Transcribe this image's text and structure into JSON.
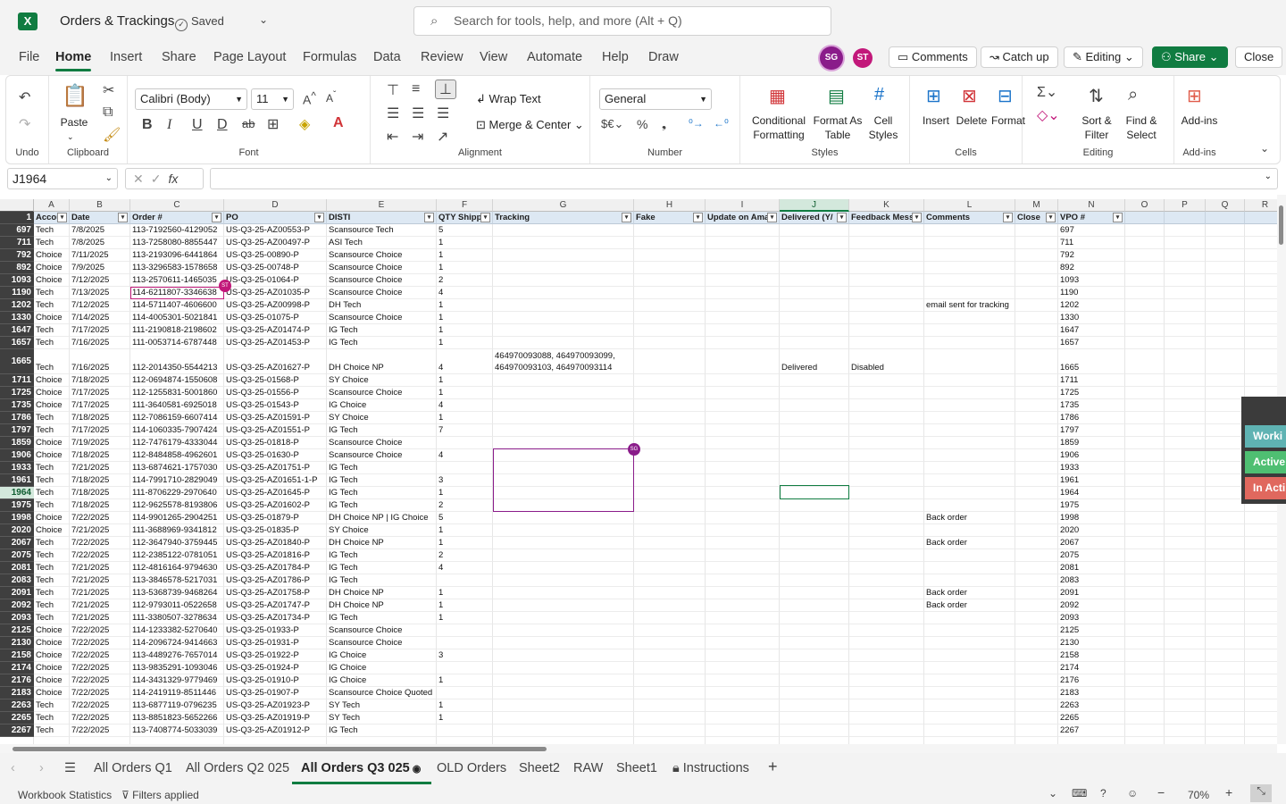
{
  "app": {
    "logo": "X",
    "title": "Orders & Trackings",
    "saved": "Saved",
    "search_placeholder": "Search for tools, help, and more (Alt + Q)"
  },
  "menu": [
    "File",
    "Home",
    "Insert",
    "Share",
    "Page Layout",
    "Formulas",
    "Data",
    "Review",
    "View",
    "Automate",
    "Help",
    "Draw"
  ],
  "header_buttons": {
    "avatar1": "SG",
    "avatar2": "ST",
    "comments": "Comments",
    "catchup": "Catch up",
    "editing": "Editing",
    "share": "Share",
    "close": "Close"
  },
  "ribbon": {
    "undo_label": "Undo",
    "clipboard": {
      "paste": "Paste",
      "label": "Clipboard"
    },
    "font": {
      "name": "Calibri (Body)",
      "size": "11",
      "label": "Font"
    },
    "alignment": {
      "wrap": "Wrap Text",
      "merge": "Merge & Center",
      "label": "Alignment"
    },
    "number": {
      "format": "General",
      "label": "Number"
    },
    "styles": {
      "cond": "Conditional Formatting",
      "table": "Format As Table",
      "cell": "Cell Styles",
      "label": "Styles"
    },
    "cells": {
      "insert": "Insert",
      "delete": "Delete",
      "format": "Format",
      "label": "Cells"
    },
    "editing": {
      "sort": "Sort & Filter",
      "find": "Find & Select",
      "label": "Editing"
    },
    "addins": {
      "btn": "Add-ins",
      "label": "Add-ins"
    }
  },
  "formula_bar": {
    "namebox": "J1964",
    "value": ""
  },
  "columns": [
    "A",
    "B",
    "C",
    "D",
    "E",
    "F",
    "G",
    "H",
    "I",
    "J",
    "K",
    "L",
    "M",
    "N",
    "O",
    "P",
    "Q",
    "R"
  ],
  "headers": [
    "Accou",
    "Date",
    "Order #",
    "PO",
    "DISTI",
    "QTY Shippe",
    "Tracking",
    "Fake",
    "Update on Ama",
    "Delivered (Y/",
    "Feedback Mess",
    "Comments",
    "Close",
    "VPO #",
    "",
    "",
    "",
    ""
  ],
  "rows": [
    {
      "n": "697",
      "a": "Tech",
      "b": "7/8/2025",
      "c": "113-7192560-4129052",
      "d": "US-Q3-25-AZ00553-P",
      "e": "Scansource Tech",
      "f": "5"
    },
    {
      "n": "711",
      "a": "Tech",
      "b": "7/8/2025",
      "c": "113-7258080-8855447",
      "d": "US-Q3-25-AZ00497-P",
      "e": "ASI Tech",
      "f": "1"
    },
    {
      "n": "792",
      "a": "Choice",
      "b": "7/11/2025",
      "c": "113-2193096-6441864",
      "d": "US-Q3-25-00890-P",
      "e": "Scansource Choice",
      "f": "1"
    },
    {
      "n": "892",
      "a": "Choice",
      "b": "7/9/2025",
      "c": "113-3296583-1578658",
      "d": "US-Q3-25-00748-P",
      "e": "Scansource Choice",
      "f": "1"
    },
    {
      "n": "1093",
      "a": "Choice",
      "b": "7/12/2025",
      "c": "113-2570611-1465035",
      "d": "US-Q3-25-01064-P",
      "e": "Scansource Choice",
      "f": "2"
    },
    {
      "n": "1190",
      "a": "Tech",
      "b": "7/13/2025",
      "c": "114-6211807-3346638",
      "d": "US-Q3-25-AZ01035-P",
      "e": "Scansource Choice",
      "f": "4"
    },
    {
      "n": "1202",
      "a": "Tech",
      "b": "7/12/2025",
      "c": "114-5711407-4606600",
      "d": "US-Q3-25-AZ00998-P",
      "e": "DH Tech",
      "f": "1",
      "l": "email sent for tracking"
    },
    {
      "n": "1330",
      "a": "Choice",
      "b": "7/14/2025",
      "c": "114-4005301-5021841",
      "d": "US-Q3-25-01075-P",
      "e": "Scansource Choice",
      "f": "1"
    },
    {
      "n": "1647",
      "a": "Tech",
      "b": "7/17/2025",
      "c": "111-2190818-2198602",
      "d": "US-Q3-25-AZ01474-P",
      "e": "IG Tech",
      "f": "1"
    },
    {
      "n": "1657",
      "a": "Tech",
      "b": "7/16/2025",
      "c": "111-0053714-6787448",
      "d": "US-Q3-25-AZ01453-P",
      "e": "IG Tech",
      "f": "1"
    },
    {
      "n": "1665",
      "a": "Tech",
      "b": "7/16/2025",
      "c": "112-2014350-5544213",
      "d": "US-Q3-25-AZ01627-P",
      "e": "DH Choice NP",
      "f": "4",
      "g": "464970093088, 464970093099,",
      "g2": "464970093103, 464970093114",
      "j": "Delivered",
      "k": "Disabled",
      "tall": true
    },
    {
      "n": "1711",
      "a": "Choice",
      "b": "7/18/2025",
      "c": "112-0694874-1550608",
      "d": "US-Q3-25-01568-P",
      "e": "SY Choice",
      "f": "1"
    },
    {
      "n": "1725",
      "a": "Choice",
      "b": "7/17/2025",
      "c": "112-1255831-5001860",
      "d": "US-Q3-25-01556-P",
      "e": "Scansource Choice",
      "f": "1"
    },
    {
      "n": "1735",
      "a": "Choice",
      "b": "7/17/2025",
      "c": "111-3640581-6925018",
      "d": "US-Q3-25-01543-P",
      "e": "IG Choice",
      "f": "4"
    },
    {
      "n": "1786",
      "a": "Tech",
      "b": "7/18/2025",
      "c": "112-7086159-6607414",
      "d": "US-Q3-25-AZ01591-P",
      "e": "SY Choice",
      "f": "1"
    },
    {
      "n": "1797",
      "a": "Tech",
      "b": "7/17/2025",
      "c": "114-1060335-7907424",
      "d": "US-Q3-25-AZ01551-P",
      "e": "IG Tech",
      "f": "7"
    },
    {
      "n": "1859",
      "a": "Choice",
      "b": "7/19/2025",
      "c": "112-7476179-4333044",
      "d": "US-Q3-25-01818-P",
      "e": "Scansource Choice",
      "f": ""
    },
    {
      "n": "1906",
      "a": "Choice",
      "b": "7/18/2025",
      "c": "112-8484858-4962601",
      "d": "US-Q3-25-01630-P",
      "e": "Scansource Choice",
      "f": "4"
    },
    {
      "n": "1933",
      "a": "Tech",
      "b": "7/21/2025",
      "c": "113-6874621-1757030",
      "d": "US-Q3-25-AZ01751-P",
      "e": "IG Tech",
      "f": ""
    },
    {
      "n": "1961",
      "a": "Tech",
      "b": "7/18/2025",
      "c": "114-7991710-2829049",
      "d": "US-Q3-25-AZ01651-1-P",
      "e": "IG Tech",
      "f": "3"
    },
    {
      "n": "1964",
      "a": "Tech",
      "b": "7/18/2025",
      "c": "111-8706229-2970640",
      "d": "US-Q3-25-AZ01645-P",
      "e": "IG Tech",
      "f": "1",
      "sel": true
    },
    {
      "n": "1975",
      "a": "Tech",
      "b": "7/18/2025",
      "c": "112-9625578-8193806",
      "d": "US-Q3-25-AZ01602-P",
      "e": "IG Tech",
      "f": "2"
    },
    {
      "n": "1998",
      "a": "Choice",
      "b": "7/22/2025",
      "c": "114-9901265-2904251",
      "d": "US-Q3-25-01879-P",
      "e": "DH Choice NP | IG Choice",
      "f": "5",
      "l": "Back order"
    },
    {
      "n": "2020",
      "a": "Choice",
      "b": "7/21/2025",
      "c": "111-3688969-9341812",
      "d": "US-Q3-25-01835-P",
      "e": "SY Choice",
      "f": "1"
    },
    {
      "n": "2067",
      "a": "Tech",
      "b": "7/22/2025",
      "c": "112-3647940-3759445",
      "d": "US-Q3-25-AZ01840-P",
      "e": "DH Choice NP",
      "f": "1",
      "l": "Back order"
    },
    {
      "n": "2075",
      "a": "Tech",
      "b": "7/22/2025",
      "c": "112-2385122-0781051",
      "d": "US-Q3-25-AZ01816-P",
      "e": "IG Tech",
      "f": "2"
    },
    {
      "n": "2081",
      "a": "Tech",
      "b": "7/21/2025",
      "c": "112-4816164-9794630",
      "d": "US-Q3-25-AZ01784-P",
      "e": "IG Tech",
      "f": "4"
    },
    {
      "n": "2083",
      "a": "Tech",
      "b": "7/21/2025",
      "c": "113-3846578-5217031",
      "d": "US-Q3-25-AZ01786-P",
      "e": "IG Tech",
      "f": ""
    },
    {
      "n": "2091",
      "a": "Tech",
      "b": "7/21/2025",
      "c": "113-5368739-9468264",
      "d": "US-Q3-25-AZ01758-P",
      "e": "DH Choice NP",
      "f": "1",
      "l": "Back order"
    },
    {
      "n": "2092",
      "a": "Tech",
      "b": "7/21/2025",
      "c": "112-9793011-0522658",
      "d": "US-Q3-25-AZ01747-P",
      "e": "DH Choice NP",
      "f": "1",
      "l": "Back order"
    },
    {
      "n": "2093",
      "a": "Tech",
      "b": "7/21/2025",
      "c": "111-3380507-3278634",
      "d": "US-Q3-25-AZ01734-P",
      "e": "IG Tech",
      "f": "1"
    },
    {
      "n": "2125",
      "a": "Choice",
      "b": "7/22/2025",
      "c": "114-1233382-5270640",
      "d": "US-Q3-25-01933-P",
      "e": "Scansource Choice",
      "f": ""
    },
    {
      "n": "2130",
      "a": "Choice",
      "b": "7/22/2025",
      "c": "114-2096724-9414663",
      "d": "US-Q3-25-01931-P",
      "e": "Scansource Choice",
      "f": ""
    },
    {
      "n": "2158",
      "a": "Choice",
      "b": "7/22/2025",
      "c": "113-4489276-7657014",
      "d": "US-Q3-25-01922-P",
      "e": "IG Choice",
      "f": "3"
    },
    {
      "n": "2174",
      "a": "Choice",
      "b": "7/22/2025",
      "c": "113-9835291-1093046",
      "d": "US-Q3-25-01924-P",
      "e": "IG Choice",
      "f": ""
    },
    {
      "n": "2176",
      "a": "Choice",
      "b": "7/22/2025",
      "c": "114-3431329-9779469",
      "d": "US-Q3-25-01910-P",
      "e": "IG Choice",
      "f": "1"
    },
    {
      "n": "2183",
      "a": "Choice",
      "b": "7/22/2025",
      "c": "114-2419119-8511446",
      "d": "US-Q3-25-01907-P",
      "e": "Scansource Choice Quoted",
      "f": ""
    },
    {
      "n": "2263",
      "a": "Tech",
      "b": "7/22/2025",
      "c": "113-6877119-0796235",
      "d": "US-Q3-25-AZ01923-P",
      "e": "SY Tech",
      "f": "1"
    },
    {
      "n": "2265",
      "a": "Tech",
      "b": "7/22/2025",
      "c": "113-8851823-5652266",
      "d": "US-Q3-25-AZ01919-P",
      "e": "SY Tech",
      "f": "1"
    },
    {
      "n": "2267",
      "a": "Tech",
      "b": "7/22/2025",
      "c": "113-7408774-5033039",
      "d": "US-Q3-25-AZ01912-P",
      "e": "IG Tech",
      "f": ""
    }
  ],
  "side_panel": {
    "b1": "Worki",
    "b2": "Active",
    "b3": "In Acti"
  },
  "sheet_tabs": [
    "All Orders Q1",
    "All Orders Q2 025",
    "All Orders Q3 025",
    "OLD Orders",
    "Sheet2",
    "RAW",
    "Sheet1",
    "Instructions"
  ],
  "status": {
    "stats": "Workbook Statistics",
    "filters": "Filters applied",
    "zoom": "70%"
  },
  "colors": {
    "brand": "#107c41",
    "avatar_sg": "#8a1c8a",
    "avatar_st": "#c2187a",
    "working": "#5fb3b3",
    "active": "#4fbf72",
    "inactive": "#e0685e"
  }
}
